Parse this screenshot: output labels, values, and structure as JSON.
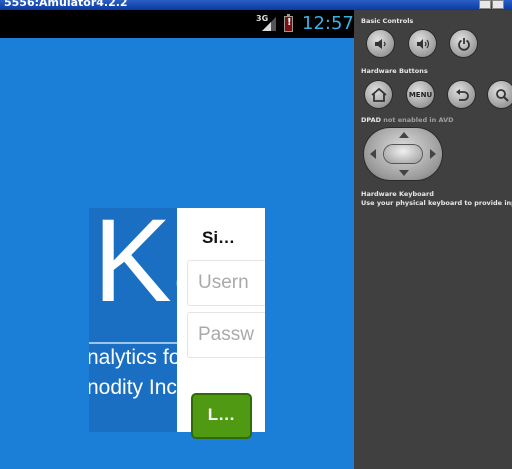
{
  "window": {
    "title": "5556:Amulator4.2.2"
  },
  "status_bar": {
    "network": "3G",
    "time": "12:57"
  },
  "app": {
    "logo_letters": "Kä",
    "tagline_line1": "nalytics fo",
    "tagline_line2": "nodity Inc",
    "dialog": {
      "title": "Si…",
      "username_placeholder": "Usern",
      "password_placeholder": "Passw",
      "login_label": "L…"
    }
  },
  "controls": {
    "basic_controls_label": "Basic Controls",
    "hardware_buttons_label": "Hardware Buttons",
    "menu_label": "MENU",
    "dpad_label": "DPAD",
    "dpad_note": "not enabled in AVD",
    "hardware_keyboard_label": "Hardware Keyboard",
    "hardware_keyboard_note": "Use your physical keyboard to provide input"
  },
  "colors": {
    "screen_background": "#1b7fd8",
    "login_button": "#4f9a12",
    "clock": "#39b1e6",
    "panel_background": "#404040"
  }
}
